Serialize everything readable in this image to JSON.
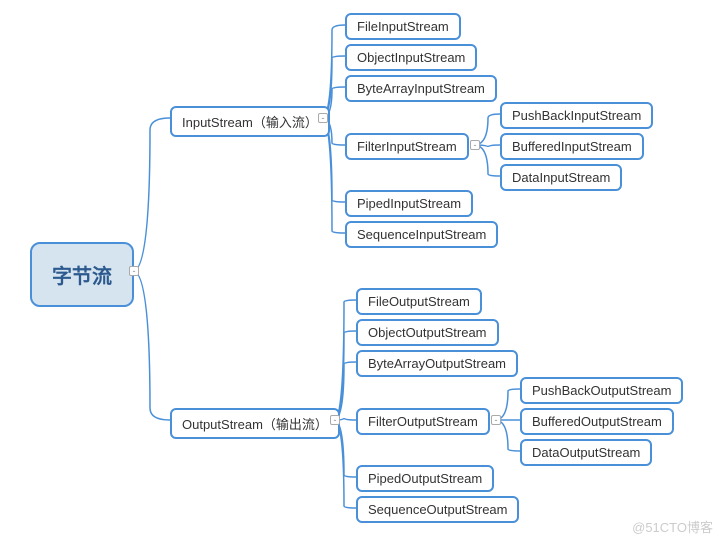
{
  "root": {
    "label": "字节流"
  },
  "branches": [
    {
      "label": "InputStream（输入流）",
      "children": [
        {
          "label": "FileInputStream"
        },
        {
          "label": "ObjectInputStream"
        },
        {
          "label": "ByteArrayInputStream"
        },
        {
          "label": "FilterInputStream",
          "children": [
            {
              "label": "PushBackInputStream"
            },
            {
              "label": "BufferedInputStream"
            },
            {
              "label": "DataInputStream"
            }
          ]
        },
        {
          "label": "PipedInputStream"
        },
        {
          "label": "SequenceInputStream"
        }
      ]
    },
    {
      "label": "OutputStream（输出流）",
      "children": [
        {
          "label": "FileOutputStream"
        },
        {
          "label": "ObjectOutputStream"
        },
        {
          "label": "ByteArrayOutputStream"
        },
        {
          "label": "FilterOutputStream",
          "children": [
            {
              "label": "PushBackOutputStream"
            },
            {
              "label": "BufferedOutputStream"
            },
            {
              "label": "DataOutputStream"
            }
          ]
        },
        {
          "label": "PipedOutputStream"
        },
        {
          "label": "SequenceOutputStream"
        }
      ]
    }
  ],
  "watermark": "@51CTO博客",
  "chart_data": {
    "type": "tree",
    "title": "字节流",
    "root": "字节流",
    "children": [
      {
        "name": "InputStream（输入流）",
        "children": [
          "FileInputStream",
          "ObjectInputStream",
          "ByteArrayInputStream",
          {
            "name": "FilterInputStream",
            "children": [
              "PushBackInputStream",
              "BufferedInputStream",
              "DataInputStream"
            ]
          },
          "PipedInputStream",
          "SequenceInputStream"
        ]
      },
      {
        "name": "OutputStream（输出流）",
        "children": [
          "FileOutputStream",
          "ObjectOutputStream",
          "ByteArrayOutputStream",
          {
            "name": "FilterOutputStream",
            "children": [
              "PushBackOutputStream",
              "BufferedOutputStream",
              "DataOutputStream"
            ]
          },
          "PipedOutputStream",
          "SequenceOutputStream"
        ]
      }
    ]
  }
}
